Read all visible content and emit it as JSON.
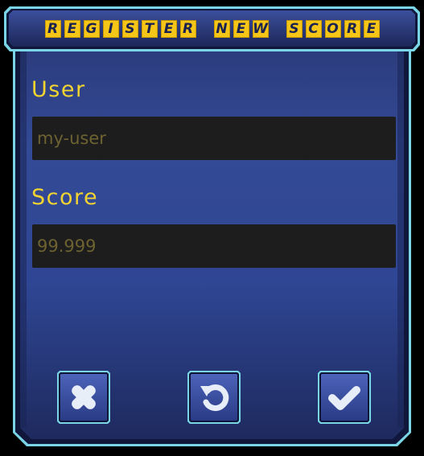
{
  "dialog": {
    "title_words": [
      "REGISTER",
      "NEW",
      "SCORE"
    ]
  },
  "form": {
    "user_label": "User",
    "user_placeholder": "my-user",
    "score_label": "Score",
    "score_placeholder": "99.999"
  },
  "buttons": {
    "cancel_icon": "close-icon",
    "reset_icon": "undo-icon",
    "confirm_icon": "checkmark-icon"
  },
  "colors": {
    "accent_cyan": "#7ad6e6",
    "title_yellow": "#f5c518",
    "label_yellow": "#f2d431",
    "panel_blue": "#2b3f8c",
    "input_bg": "#1d1d1e"
  }
}
